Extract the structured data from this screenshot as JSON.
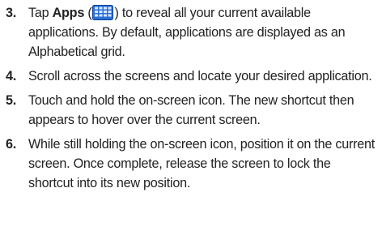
{
  "steps": [
    {
      "number": "3.",
      "pre": "Tap ",
      "bold": "Apps",
      "open_paren": " (",
      "icon": "apps-grid-icon",
      "post": ") to reveal all your current available applications. By default, applications are displayed as an Alphabetical grid."
    },
    {
      "number": "4.",
      "text": "Scroll across the screens and locate your desired application."
    },
    {
      "number": "5.",
      "text": "Touch and hold the on-screen icon. The new shortcut then appears to hover over the current screen."
    },
    {
      "number": "6.",
      "text": "While still holding the on-screen icon, position it on the current screen. Once complete, release the screen to lock the shortcut into its new position."
    }
  ],
  "colors": {
    "icon_fill": "#2b6fd6",
    "icon_border": "#0d3f93",
    "icon_grid": "#d9e8ff",
    "text": "#222222"
  }
}
